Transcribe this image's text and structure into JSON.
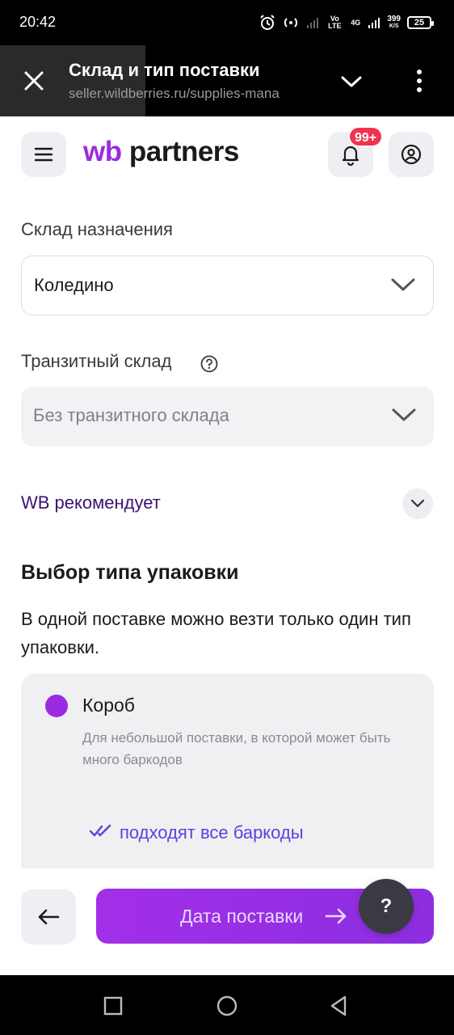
{
  "status_bar": {
    "time": "20:42",
    "net_speed": "399",
    "net_speed_unit": "K/S",
    "net_type": "4G",
    "volte": "Vo LTE",
    "battery": "25"
  },
  "browser": {
    "title": "Склад и тип поставки",
    "url": "seller.wildberries.ru/supplies-mana"
  },
  "header": {
    "logo_wb": "wb",
    "logo_partners": "partners",
    "notification_badge": "99+"
  },
  "form": {
    "warehouse_label": "Склад назначения",
    "warehouse_value": "Коледино",
    "transit_label": "Транзитный склад",
    "transit_value": "Без транзитного склада",
    "recommends_label": "WB рекомендует"
  },
  "packaging": {
    "heading": "Выбор типа упаковки",
    "description": "В одной поставке можно везти только один тип упаковки.",
    "option_title": "Короб",
    "option_description": "Для небольшой поставки, в которой может быть много баркодов",
    "option_note": "подходят все баркоды"
  },
  "actions": {
    "next_label": "Дата поставки",
    "help_label": "?"
  },
  "colors": {
    "accent": "#9b2be2",
    "badge": "#f0344f",
    "link": "#3b1272",
    "note": "#5e3fe0"
  }
}
